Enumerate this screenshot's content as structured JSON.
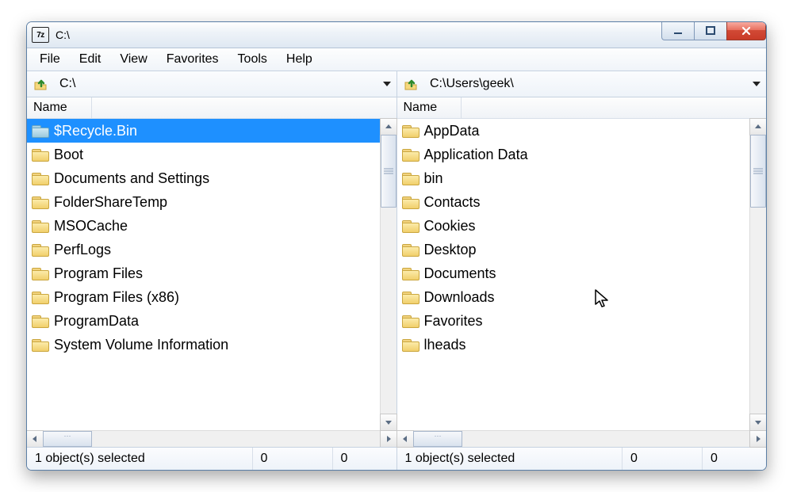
{
  "window": {
    "title": "C:\\",
    "icon_text": "7z"
  },
  "menubar": [
    "File",
    "Edit",
    "View",
    "Favorites",
    "Tools",
    "Help"
  ],
  "left": {
    "path": "C:\\",
    "column_header": "Name",
    "items": [
      {
        "name": "$Recycle.Bin",
        "selected": true
      },
      {
        "name": "Boot"
      },
      {
        "name": "Documents and Settings"
      },
      {
        "name": "FolderShareTemp"
      },
      {
        "name": "MSOCache"
      },
      {
        "name": "PerfLogs"
      },
      {
        "name": "Program Files"
      },
      {
        "name": "Program Files (x86)"
      },
      {
        "name": "ProgramData"
      },
      {
        "name": "System Volume Information"
      }
    ],
    "status_text": "1 object(s) selected",
    "status_n1": "0",
    "status_n2": "0"
  },
  "right": {
    "path": "C:\\Users\\geek\\",
    "column_header": "Name",
    "items": [
      {
        "name": "AppData"
      },
      {
        "name": "Application Data"
      },
      {
        "name": "bin"
      },
      {
        "name": "Contacts"
      },
      {
        "name": "Cookies"
      },
      {
        "name": "Desktop"
      },
      {
        "name": "Documents"
      },
      {
        "name": "Downloads"
      },
      {
        "name": "Favorites"
      },
      {
        "name": "lheads"
      }
    ],
    "status_text": "1 object(s) selected",
    "status_n1": "0",
    "status_n2": "0"
  }
}
